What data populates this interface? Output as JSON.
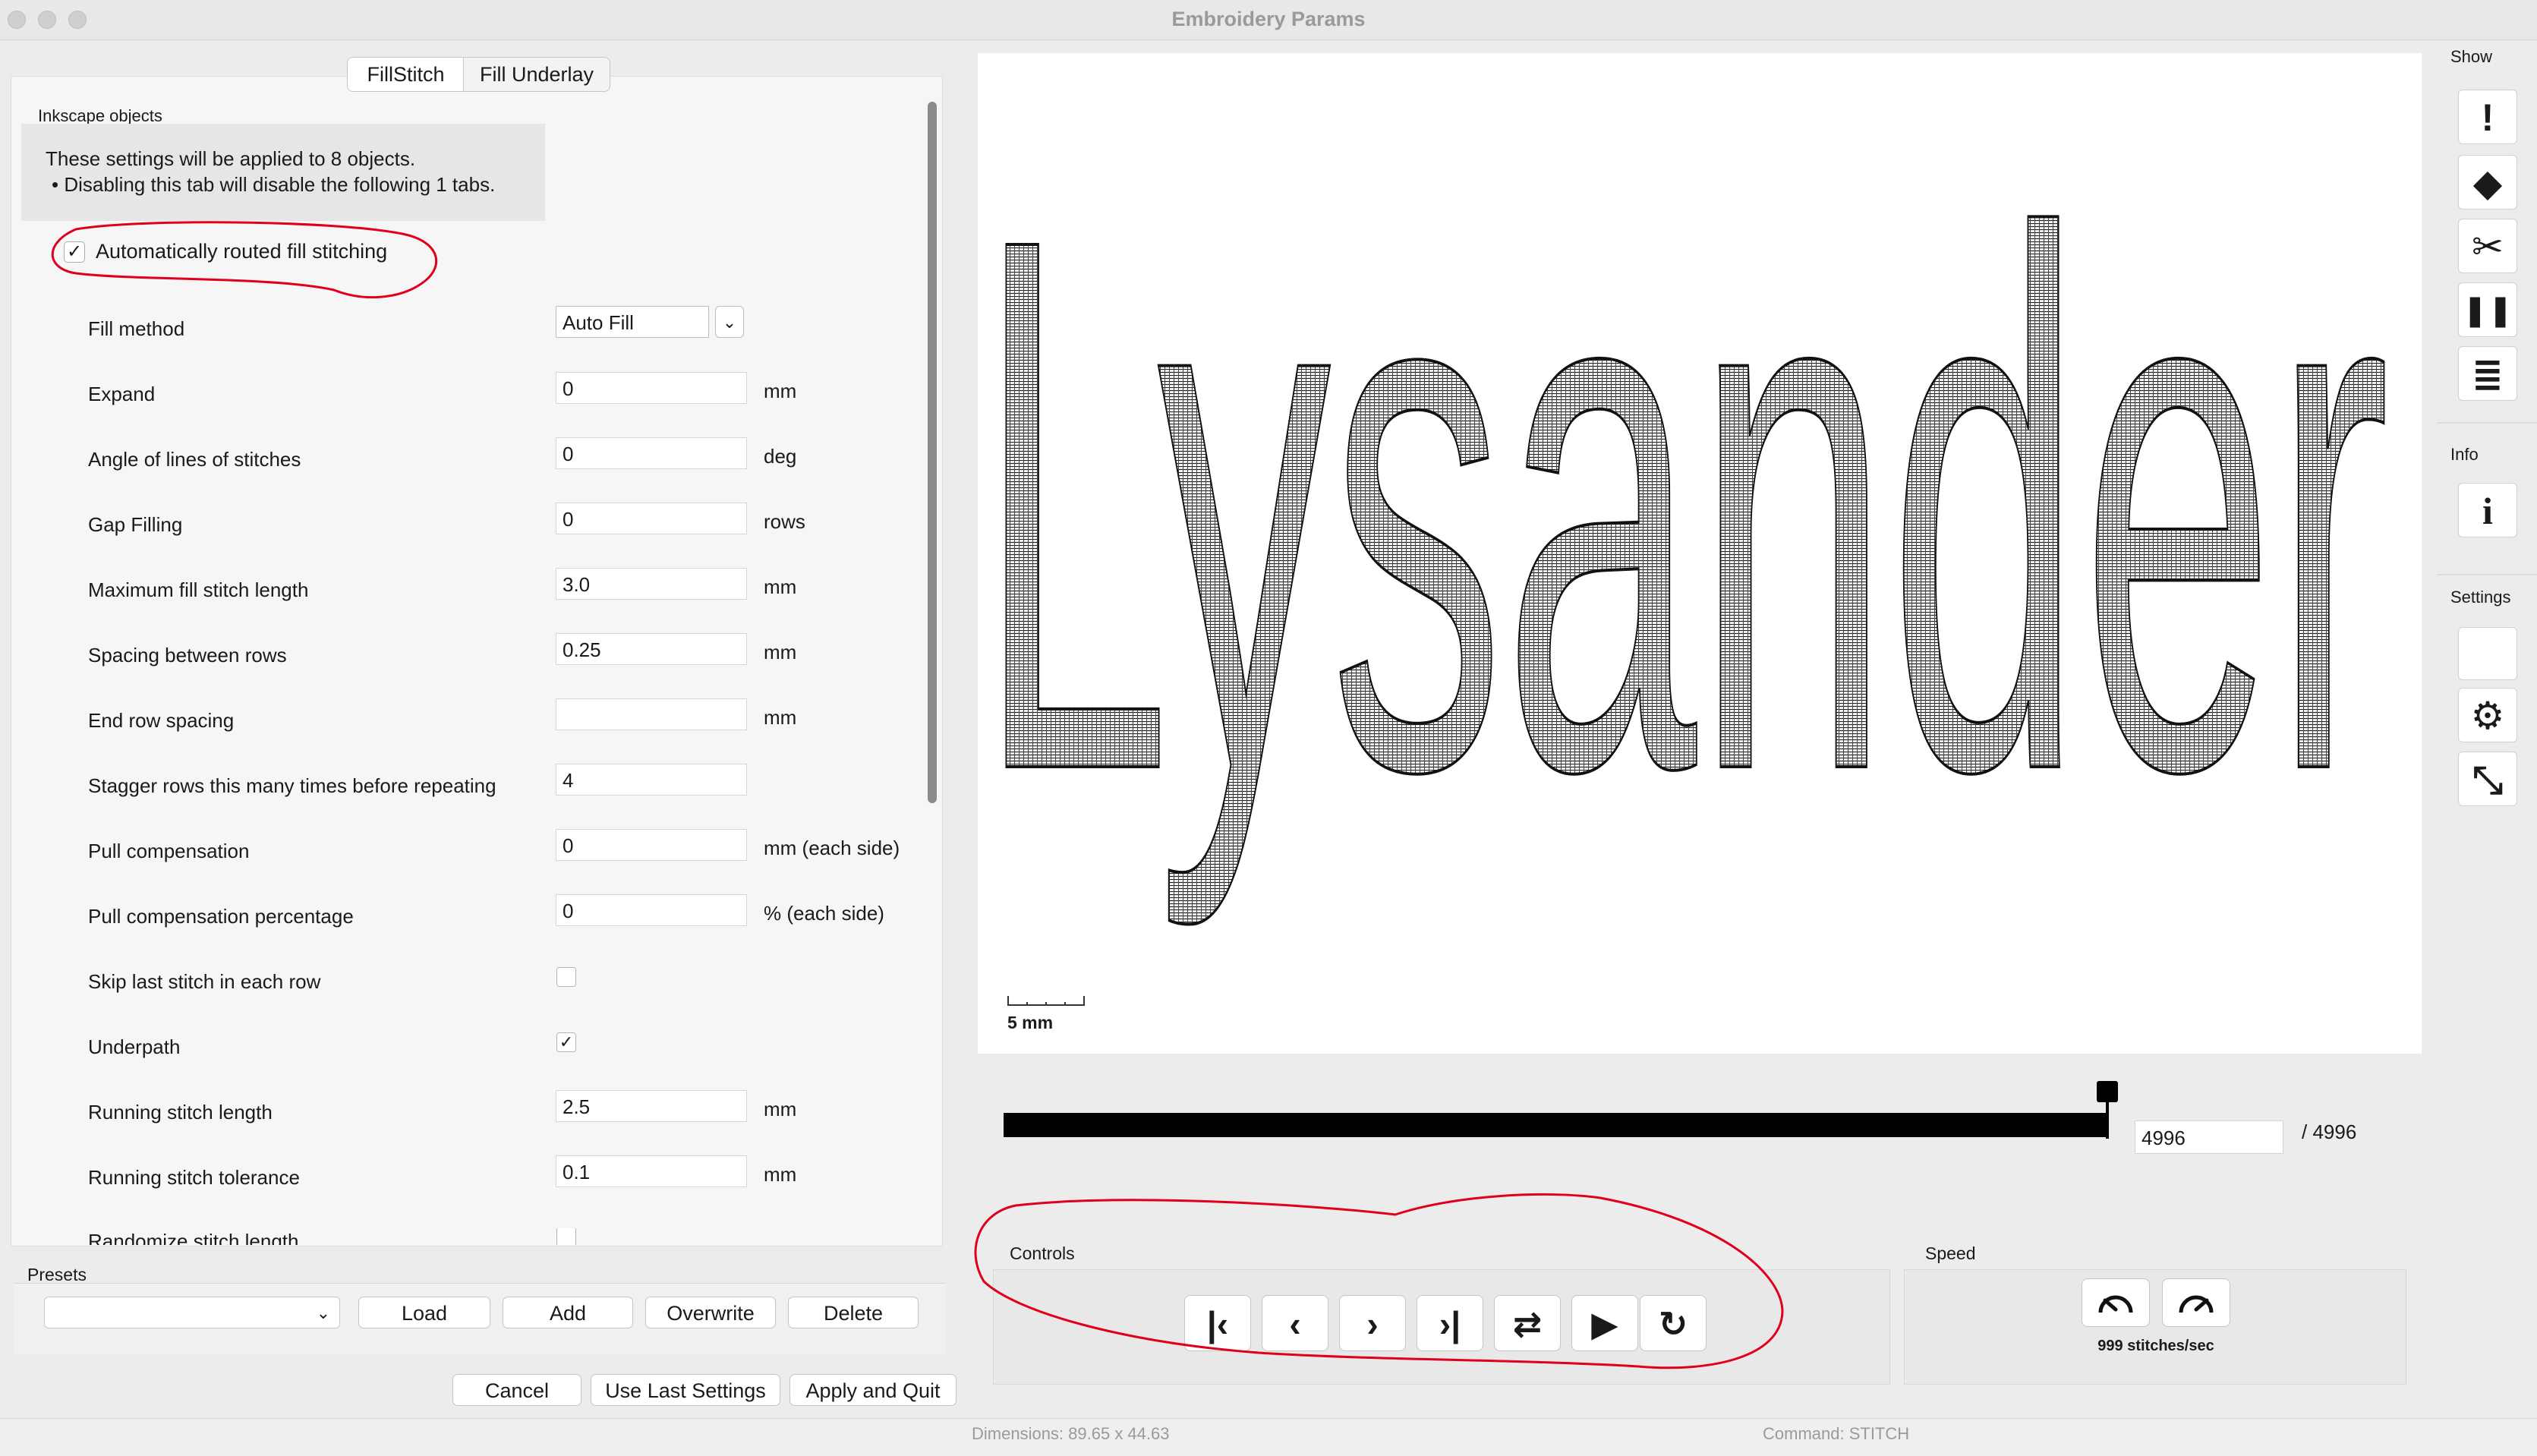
{
  "window": {
    "title": "Embroidery Params"
  },
  "tabs": [
    {
      "label": "FillStitch",
      "active": true
    },
    {
      "label": "Fill Underlay",
      "active": false
    }
  ],
  "inkscape": {
    "title": "Inkscape objects",
    "line1": "These settings will be applied to 8 objects.",
    "line2": "• Disabling this tab will disable the following 1 tabs."
  },
  "auto_fill": {
    "label": "Automatically routed fill stitching",
    "checked": true,
    "check_glyph": "✓"
  },
  "params": {
    "fill_method": {
      "label": "Fill method",
      "value": "Auto Fill",
      "dropdown_glyph": "⌄"
    },
    "expand": {
      "label": "Expand",
      "value": "0",
      "unit": "mm"
    },
    "angle": {
      "label": "Angle of lines of stitches",
      "value": "0",
      "unit": "deg"
    },
    "gap": {
      "label": "Gap Filling",
      "value": "0",
      "unit": "rows"
    },
    "max_len": {
      "label": "Maximum fill stitch length",
      "value": "3.0",
      "unit": "mm"
    },
    "spacing": {
      "label": "Spacing between rows",
      "value": "0.25",
      "unit": "mm"
    },
    "end_spacing": {
      "label": "End row spacing",
      "value": "",
      "unit": "mm"
    },
    "stagger": {
      "label": "Stagger rows this many times before repeating",
      "value": "4"
    },
    "pull_comp": {
      "label": "Pull compensation",
      "value": "0",
      "unit": "mm (each side)"
    },
    "pull_pct": {
      "label": "Pull compensation percentage",
      "value": "0",
      "unit": "% (each side)"
    },
    "skip_last": {
      "label": "Skip last stitch in each row",
      "checked": false,
      "glyph": ""
    },
    "underpath": {
      "label": "Underpath",
      "checked": true,
      "glyph": "✓"
    },
    "run_len": {
      "label": "Running stitch length",
      "value": "2.5",
      "unit": "mm"
    },
    "run_tol": {
      "label": "Running stitch tolerance",
      "value": "0.1",
      "unit": "mm"
    },
    "randomize": {
      "label": "Randomize stitch length",
      "checked": false,
      "glyph": ""
    }
  },
  "presets": {
    "label": "Presets",
    "select_glyph": "⌄",
    "load": "Load",
    "add": "Add",
    "overwrite": "Overwrite",
    "delete": "Delete"
  },
  "actions": {
    "cancel": "Cancel",
    "use_last": "Use Last Settings",
    "apply_quit": "Apply and Quit"
  },
  "preview": {
    "text": "Lysander",
    "scale_label": "5 mm",
    "progress_fraction": 1.0
  },
  "stitch_counter": {
    "value": "4996",
    "total": "/ 4996"
  },
  "controls": {
    "label": "Controls",
    "buttons": [
      {
        "icon": "skip-to-start-icon",
        "glyph": "|‹"
      },
      {
        "icon": "step-back-icon",
        "glyph": "‹"
      },
      {
        "icon": "step-forward-icon",
        "glyph": "›"
      },
      {
        "icon": "skip-to-end-icon",
        "glyph": "›|"
      },
      {
        "icon": "swap-direction-icon",
        "glyph": "⇄"
      },
      {
        "icon": "play-icon",
        "glyph": "▶"
      },
      {
        "icon": "restart-icon",
        "glyph": "↻"
      }
    ]
  },
  "speed": {
    "label": "Speed",
    "value": "999 stitches/sec",
    "slower_icon": "speed-down-icon",
    "faster_icon": "speed-up-icon"
  },
  "sidebar": {
    "show_label": "Show",
    "info_label": "Info",
    "settings_label": "Settings",
    "show_buttons": [
      {
        "icon": "warning-icon",
        "glyph": "!"
      },
      {
        "icon": "frog-icon",
        "glyph": "◆"
      },
      {
        "icon": "scissors-icon",
        "glyph": "✂"
      },
      {
        "icon": "pause-icon",
        "glyph": "❚❚"
      },
      {
        "icon": "stitch-list-icon",
        "glyph": "≣"
      }
    ],
    "info_glyph": "i",
    "settings_glyph": "⚙",
    "resize_glyph": "⤡"
  },
  "colors": {
    "annotation_red": "#e0001b",
    "stitch": "#111111"
  },
  "status": {
    "dimensions": "Dimensions: 89.65 x 44.63",
    "command": "Command: STITCH"
  }
}
